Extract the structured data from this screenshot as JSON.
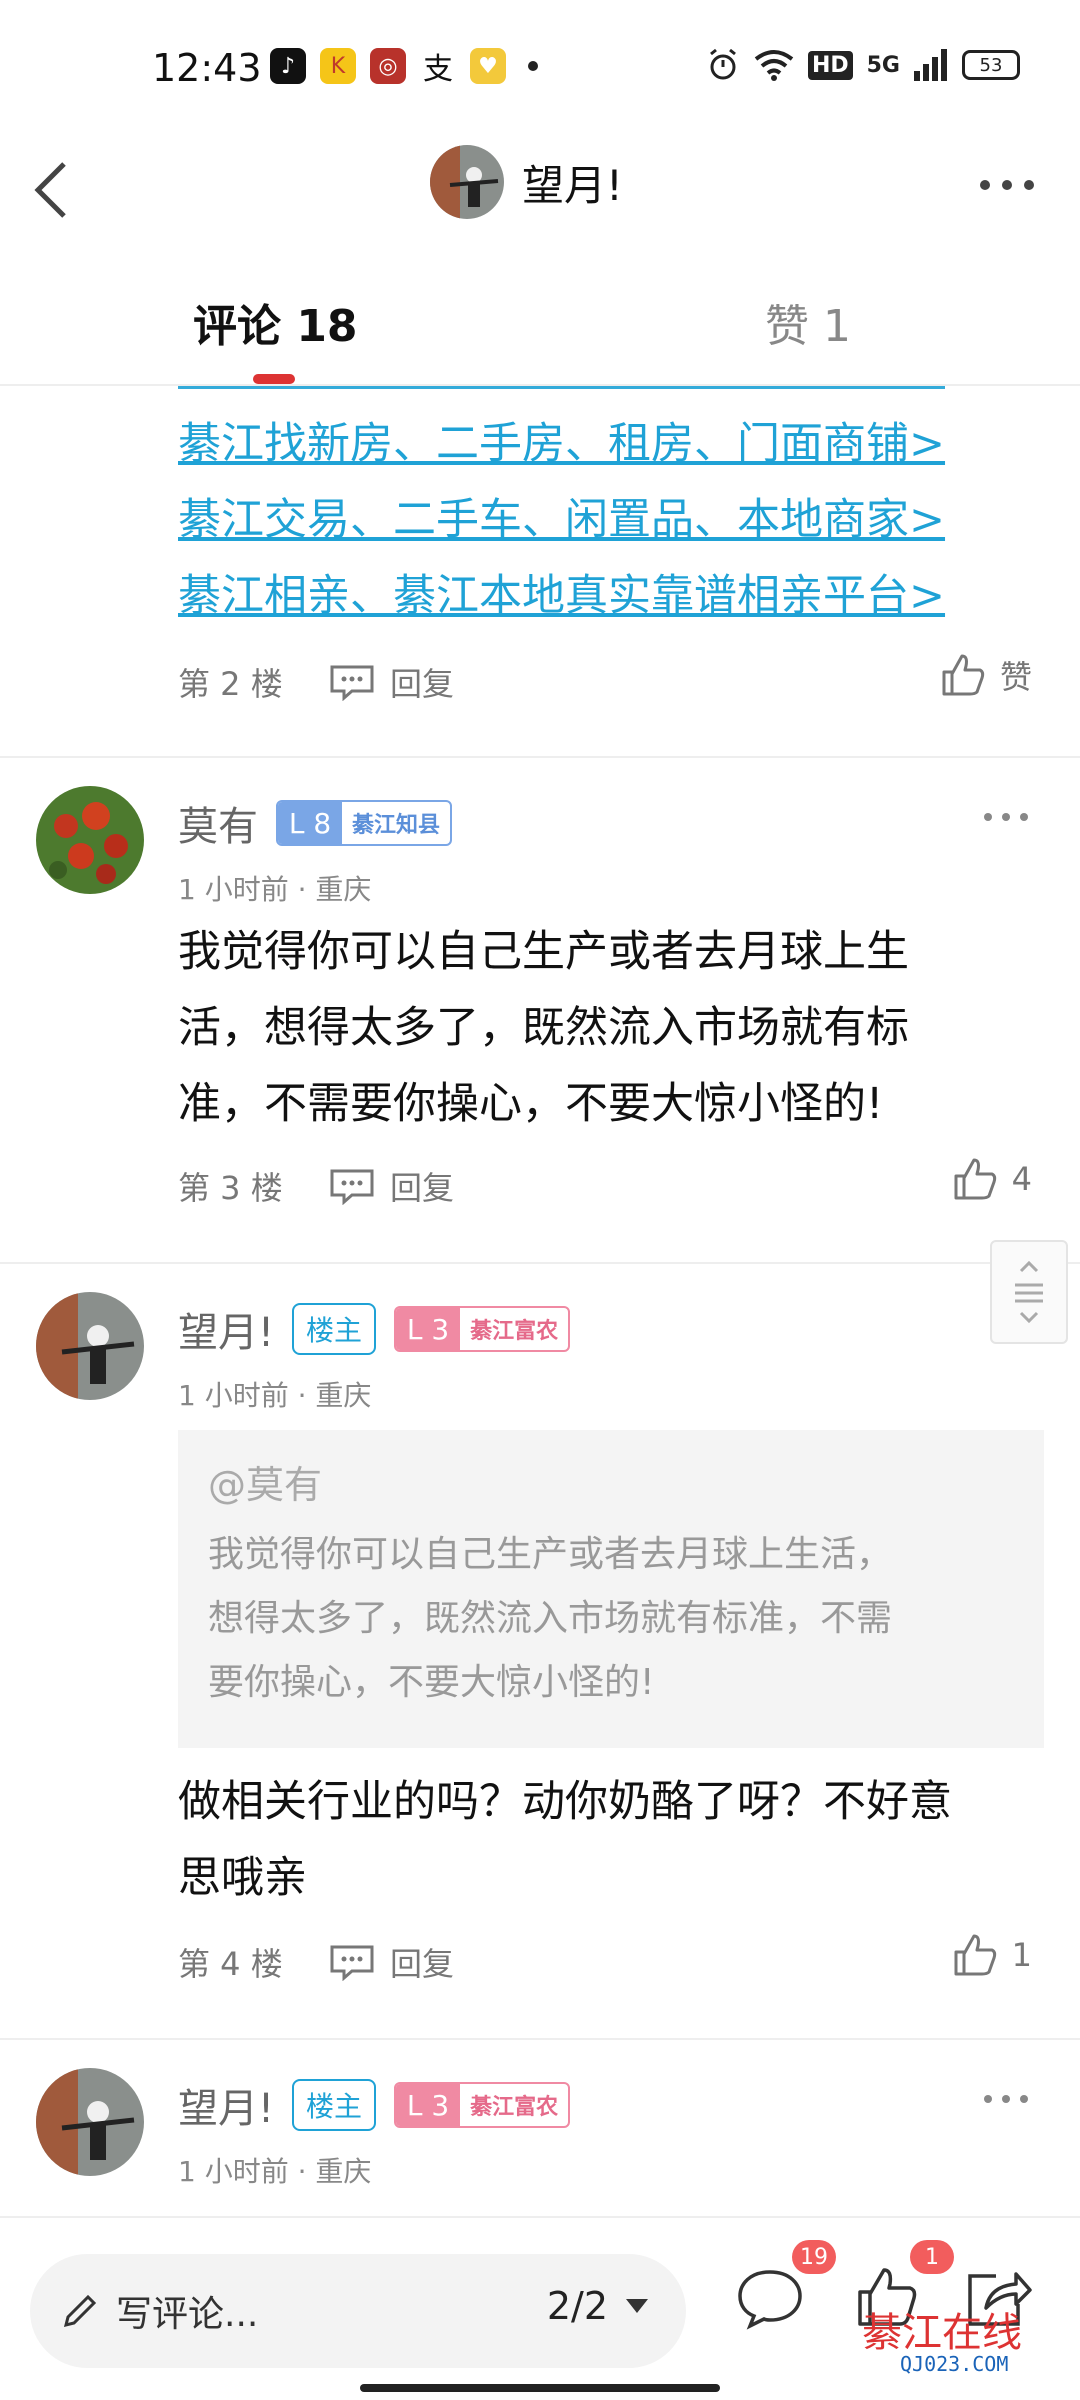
{
  "status_bar": {
    "time": "12:43",
    "battery": "53",
    "hd": "HD",
    "network": "5G"
  },
  "header": {
    "author_name": "望月!"
  },
  "tabs": {
    "comments": "评论 18",
    "likes": "赞 1"
  },
  "links": [
    "綦江找新房、二手房、租房、门面商铺>",
    "綦江交易、二手车、闲置品、本地商家>",
    "綦江相亲、綦江本地真实靠谱相亲平台>"
  ],
  "post2": {
    "floor": "第 2 楼",
    "reply": "回复",
    "like": "赞"
  },
  "comment3": {
    "name": "莫有",
    "level": "L 8",
    "level_title": "綦江知县",
    "meta": "1 小时前 · 重庆",
    "lines": [
      "我觉得你可以自己生产或者去月球上生",
      "活，想得太多了，既然流入市场就有标",
      "准，不需要你操心，不要大惊小怪的!"
    ],
    "floor": "第 3 楼",
    "reply": "回复",
    "likes": "4"
  },
  "comment4": {
    "name": "望月!",
    "owner_badge": "楼主",
    "level": "L 3",
    "level_title": "綦江富农",
    "meta": "1 小时前 · 重庆",
    "quote_user": "@莫有",
    "quote_lines": [
      "我觉得你可以自己生产或者去月球上生活，",
      "想得太多了，既然流入市场就有标准，不需",
      "要你操心，不要大惊小怪的!"
    ],
    "lines": [
      "做相关行业的吗？动你奶酪了呀？不好意",
      "思哦亲"
    ],
    "floor": "第 4 楼",
    "reply": "回复",
    "likes": "1"
  },
  "comment5": {
    "name": "望月!",
    "owner_badge": "楼主",
    "level": "L 3",
    "level_title": "綦江富农",
    "meta": "1 小时前 · 重庆"
  },
  "bottom_bar": {
    "write_placeholder": "写评论...",
    "page": "2/2",
    "comment_count": "19",
    "like_count": "1"
  },
  "watermark": {
    "main": "綦江在线",
    "sub": "QJ023.COM"
  }
}
